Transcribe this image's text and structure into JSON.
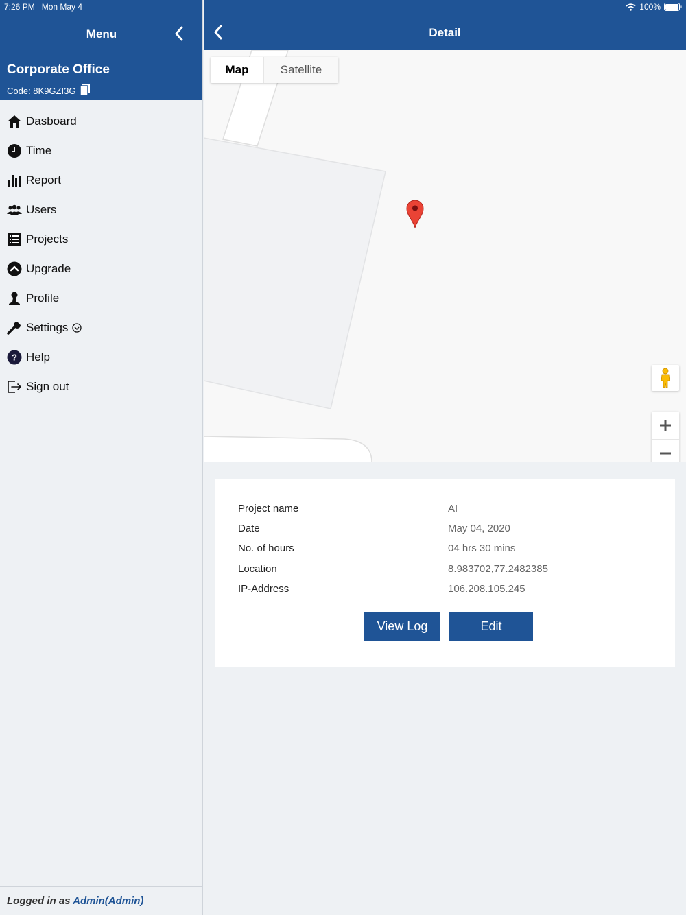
{
  "status": {
    "time": "7:26 PM",
    "date": "Mon May 4",
    "battery": "100%"
  },
  "menu": {
    "title": "Menu"
  },
  "org": {
    "name": "Corporate Office",
    "code": "Code: 8K9GZI3G"
  },
  "nav": [
    {
      "label": "Dasboard",
      "icon": "home-icon"
    },
    {
      "label": "Time",
      "icon": "clock-icon"
    },
    {
      "label": "Report",
      "icon": "bar-chart-icon"
    },
    {
      "label": "Users",
      "icon": "users-icon"
    },
    {
      "label": "Projects",
      "icon": "list-icon"
    },
    {
      "label": "Upgrade",
      "icon": "upgrade-icon"
    },
    {
      "label": "Profile",
      "icon": "person-icon"
    },
    {
      "label": "Settings",
      "icon": "wrench-icon"
    },
    {
      "label": "Help",
      "icon": "help-icon"
    },
    {
      "label": "Sign out",
      "icon": "sign-out-icon"
    }
  ],
  "footer": {
    "prefix": "Logged in as ",
    "user": "Admin(Admin)"
  },
  "detail": {
    "title": "Detail"
  },
  "map": {
    "map_label": "Map",
    "satellite_label": "Satellite"
  },
  "info": [
    {
      "key": "Project name",
      "value": "AI"
    },
    {
      "key": "Date",
      "value": "May 04, 2020"
    },
    {
      "key": "No. of hours",
      "value": "04 hrs 30 mins"
    },
    {
      "key": "Location",
      "value": "8.983702,77.2482385"
    },
    {
      "key": "IP-Address",
      "value": "106.208.105.245"
    }
  ],
  "actions": {
    "view_log": "View Log",
    "edit": "Edit"
  },
  "colors": {
    "brand": "#1f5496",
    "pin": "#ea4335"
  }
}
